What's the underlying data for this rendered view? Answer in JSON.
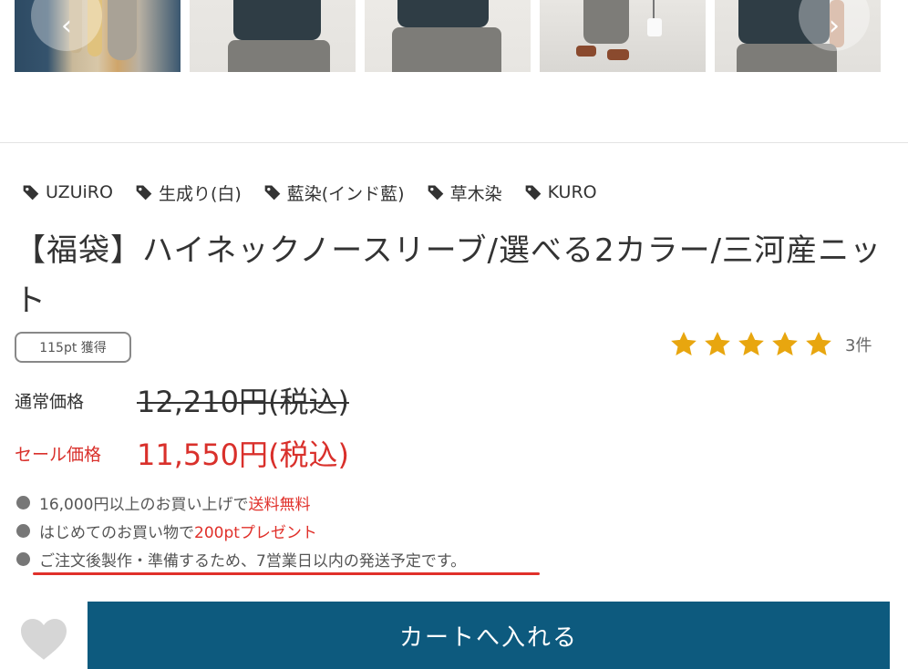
{
  "gallery": {
    "prev_icon": "chevron-left-icon",
    "next_icon": "chevron-right-icon",
    "prev_glyph": "‹",
    "next_glyph": "›"
  },
  "tags": [
    {
      "label": "UZUiRO",
      "icon": "tag-icon"
    },
    {
      "label": "生成り(白)",
      "icon": "tag-icon"
    },
    {
      "label": "藍染(インド藍)",
      "icon": "tag-icon"
    },
    {
      "label": "草木染",
      "icon": "tag-icon"
    },
    {
      "label": "KURO",
      "icon": "tag-icon"
    }
  ],
  "product": {
    "title": "【福袋】ハイネックノースリーブ/選べる2カラー/三河産ニット",
    "points_badge": "115pt 獲得"
  },
  "rating": {
    "stars": 5,
    "max_stars": 5,
    "count": "3件",
    "star_color": "#e8a60f"
  },
  "price": {
    "regular_label": "通常価格",
    "regular_value": "12,210円(税込)",
    "sale_label": "セール価格",
    "sale_value": "11,550円(税込)"
  },
  "notes": [
    {
      "text": "16,000円以上のお買い上げで",
      "highlight": "送料無料"
    },
    {
      "text": "はじめてのお買い物で",
      "highlight": "200ptプレゼント"
    },
    {
      "text": "ご注文後製作・準備するため、7営業日以内の発送予定です。",
      "highlight": ""
    }
  ],
  "actions": {
    "favorite_icon": "heart-icon",
    "cart_label": "カートへ入れる"
  },
  "colors": {
    "accent_red": "#d9302b",
    "cart_button": "#0d5a7e"
  }
}
